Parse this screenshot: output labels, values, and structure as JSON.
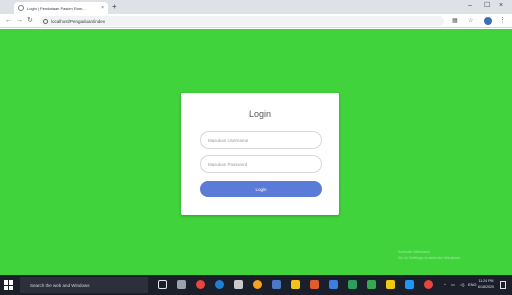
{
  "browser": {
    "tab_title": "Login | Pendataan Pasien Rum...",
    "tab_close": "×",
    "new_tab": "+",
    "url": "localhost/Pengaduan/index",
    "minimize": "–",
    "maximize": "☐",
    "close": "×"
  },
  "page": {
    "background_color": "#41d33c"
  },
  "login": {
    "title": "Login",
    "username_placeholder": "Masukan Username",
    "password_placeholder": "Masukan Password",
    "button_label": "Login",
    "button_color": "#5b7bd8"
  },
  "watermark": {
    "line1": "Activate Windows",
    "line2": "Go to Settings to activate Windows."
  },
  "taskbar": {
    "search_placeholder": "Search the web and Windows",
    "tray_lang": "ENG",
    "time": "11:24 PM",
    "date": "6/18/2020"
  }
}
